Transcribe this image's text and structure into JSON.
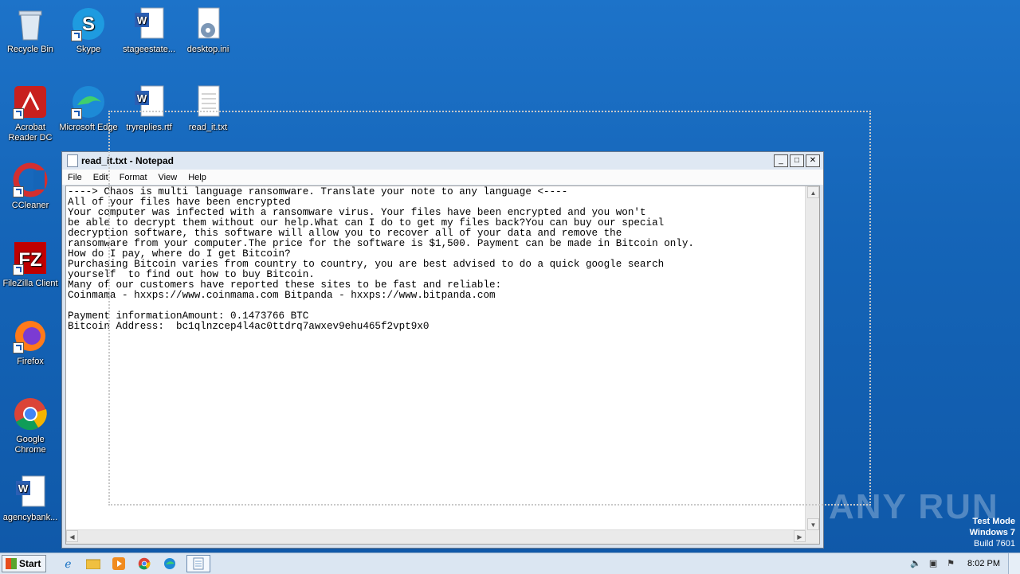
{
  "desktop": {
    "icons": [
      {
        "label": "Recycle Bin"
      },
      {
        "label": "Skype"
      },
      {
        "label": "stageestate..."
      },
      {
        "label": "desktop.ini"
      },
      {
        "label": "Acrobat Reader DC"
      },
      {
        "label": "Microsoft Edge"
      },
      {
        "label": "tryreplies.rtf"
      },
      {
        "label": "read_it.txt"
      },
      {
        "label": "CCleaner"
      },
      {
        "label": "FileZilla Client"
      },
      {
        "label": "Firefox"
      },
      {
        "label": "Google Chrome"
      },
      {
        "label": "agencybank..."
      }
    ]
  },
  "notepad": {
    "title": "read_it.txt - Notepad",
    "menu": [
      "File",
      "Edit",
      "Format",
      "View",
      "Help"
    ],
    "content": "----> Chaos is multi language ransomware. Translate your note to any language <----\nAll of your files have been encrypted\nYour computer was infected with a ransomware virus. Your files have been encrypted and you won't\nbe able to decrypt them without our help.What can I do to get my files back?You can buy our special\ndecryption software, this software will allow you to recover all of your data and remove the\nransomware from your computer.The price for the software is $1,500. Payment can be made in Bitcoin only.\nHow do I pay, where do I get Bitcoin?\nPurchasing Bitcoin varies from country to country, you are best advised to do a quick google search\nyourself  to find out how to buy Bitcoin.\nMany of our customers have reported these sites to be fast and reliable:\nCoinmama - hxxps://www.coinmama.com Bitpanda - hxxps://www.bitpanda.com\n\nPayment informationAmount: 0.1473766 BTC\nBitcoin Address:  bc1qlnzcep4l4ac0ttdrq7awxev9ehu465f2vpt9x0"
  },
  "watermark": "ANY RUN",
  "testmode": {
    "line1": "Test Mode",
    "line2": "Windows 7",
    "line3": "Build 7601"
  },
  "taskbar": {
    "start_label": "Start",
    "clock": "8:02 PM"
  }
}
